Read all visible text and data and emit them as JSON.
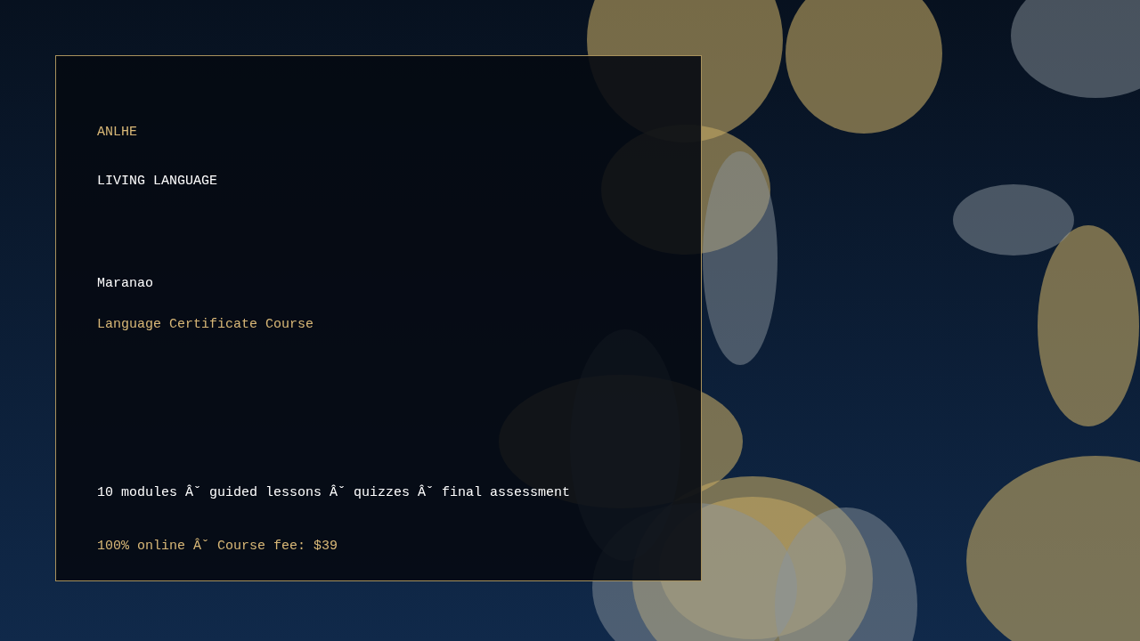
{
  "card": {
    "brand": "ANLHE",
    "tagline": "LIVING LANGUAGE",
    "language": "Maranao",
    "course": "Language Certificate Course",
    "features": "10 modules Âˇ guided lessons Âˇ quizzes Âˇ final assessment",
    "pricing": "100% online Âˇ Course fee: $39"
  }
}
